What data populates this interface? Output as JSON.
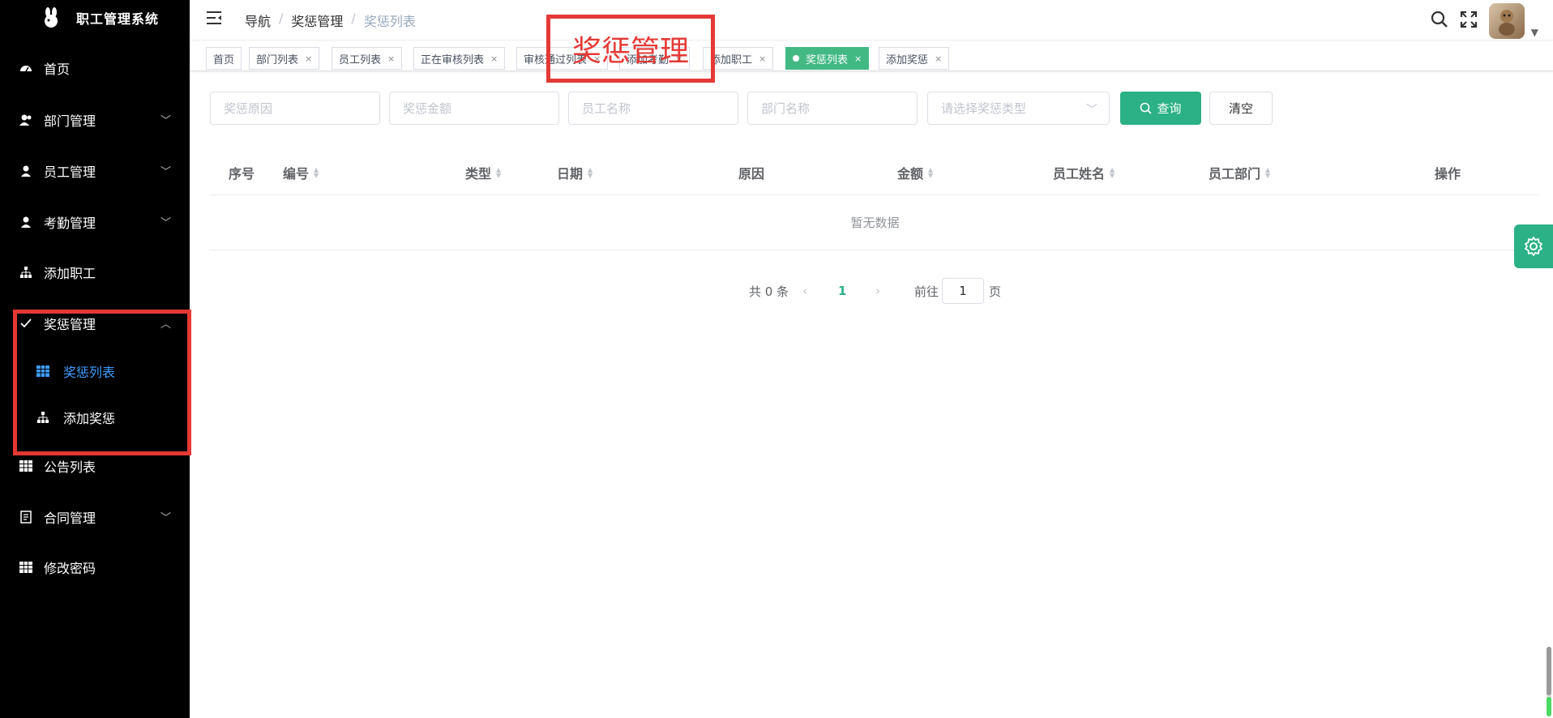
{
  "app": {
    "title": "职工管理系统"
  },
  "sidebar": {
    "items": [
      {
        "label": "首页",
        "icon": "dashboard-icon"
      },
      {
        "label": "部门管理",
        "icon": "users-icon"
      },
      {
        "label": "员工管理",
        "icon": "user-icon"
      },
      {
        "label": "考勤管理",
        "icon": "user-icon"
      },
      {
        "label": "添加职工",
        "icon": "org-tree-icon"
      },
      {
        "label": "奖惩管理",
        "icon": "check-icon"
      },
      {
        "label": "公告列表",
        "icon": "grid-icon"
      },
      {
        "label": "合同管理",
        "icon": "document-icon"
      },
      {
        "label": "修改密码",
        "icon": "grid-icon"
      }
    ],
    "submenu": [
      {
        "label": "奖惩列表",
        "icon": "table-icon"
      },
      {
        "label": "添加奖惩",
        "icon": "org-tree-icon"
      }
    ]
  },
  "header": {
    "breadcrumb": [
      "导航",
      "奖惩管理",
      "奖惩列表"
    ]
  },
  "tags": [
    {
      "label": "首页"
    },
    {
      "label": "部门列表"
    },
    {
      "label": "员工列表"
    },
    {
      "label": "正在审核列表"
    },
    {
      "label": "审核通过列表"
    },
    {
      "label": "添加考勤"
    },
    {
      "label": "添加职工"
    },
    {
      "label": "奖惩列表"
    },
    {
      "label": "添加奖惩"
    }
  ],
  "annotation": {
    "text": "奖惩管理"
  },
  "filters": {
    "reason_placeholder": "奖惩原因",
    "amount_placeholder": "奖惩金额",
    "employee_placeholder": "员工名称",
    "dept_placeholder": "部门名称",
    "type_placeholder": "请选择奖惩类型",
    "search_label": "查询",
    "clear_label": "清空"
  },
  "table": {
    "columns": [
      "序号",
      "编号",
      "类型",
      "日期",
      "原因",
      "金额",
      "员工姓名",
      "员工部门",
      "操作"
    ],
    "empty_text": "暂无数据"
  },
  "pagination": {
    "total_text": "共 0 条",
    "current_page": "1",
    "goto_label": "前往",
    "goto_value": "1",
    "page_suffix": "页"
  },
  "colors": {
    "accent": "#2bb185",
    "active_menu": "#409eff",
    "annotation": "#e53935"
  }
}
